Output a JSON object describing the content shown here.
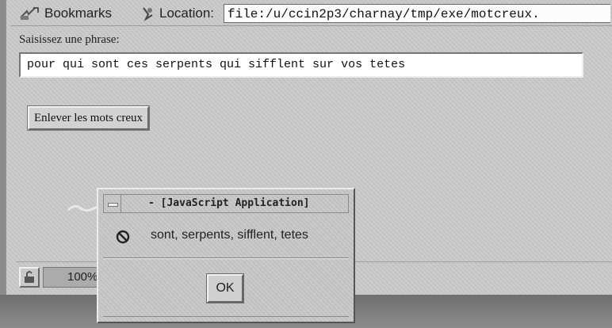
{
  "toolbar": {
    "bookmarks_label": "Bookmarks",
    "location_label": "Location:",
    "url": "file:/u/ccin2p3/charnay/tmp/exe/motcreux.",
    "bookmarks_icon": "bookmark-icon",
    "location_icon": "location-icon"
  },
  "form": {
    "prompt": "Saisissez une phrase:",
    "phrase_value": "pour qui sont ces serpents qui sifflent sur vos tetes",
    "button_label": "Enlever les mots creux"
  },
  "statusbar": {
    "progress_text": "100%",
    "lock_icon": "lock-icon"
  },
  "dialog": {
    "title": "- [JavaScript Application]",
    "message": "sont, serpents, sifflent, tetes",
    "message_icon": "no-entry-icon",
    "ok_label": "OK"
  }
}
